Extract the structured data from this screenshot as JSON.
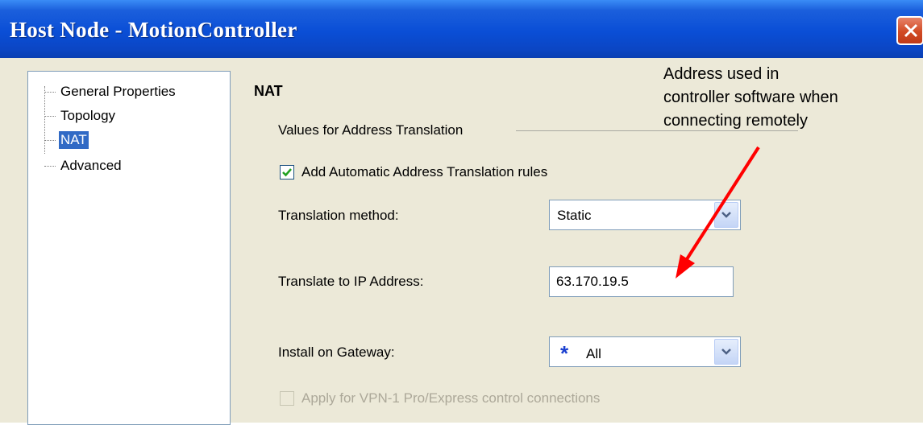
{
  "window": {
    "title": "Host Node - MotionController"
  },
  "tree": {
    "items": [
      {
        "label": "General Properties",
        "selected": false
      },
      {
        "label": "Topology",
        "selected": false
      },
      {
        "label": "NAT",
        "selected": true
      },
      {
        "label": "Advanced",
        "selected": false
      }
    ]
  },
  "nat": {
    "section_title": "NAT",
    "group_label": "Values for Address Translation",
    "auto_rules": {
      "label": "Add Automatic Address Translation rules",
      "checked": true
    },
    "translation_method": {
      "label": "Translation method:",
      "value": "Static"
    },
    "ip_address": {
      "label": "Translate to IP Address:",
      "value": "63.170.19.5"
    },
    "gateway": {
      "label": "Install on Gateway:",
      "star": "*",
      "value": "All"
    },
    "vpn": {
      "label": "Apply for VPN-1 Pro/Express control connections",
      "checked": false,
      "enabled": false
    }
  },
  "annotation": {
    "line1": "Address used in",
    "line2": "controller software when",
    "line3": "connecting remotely",
    "arrow_color": "#ff0000"
  },
  "colors": {
    "title_bar": "#0a4ed6",
    "selection": "#316ac5",
    "dialog_bg": "#ece9d8",
    "star": "#1a3fd0"
  }
}
